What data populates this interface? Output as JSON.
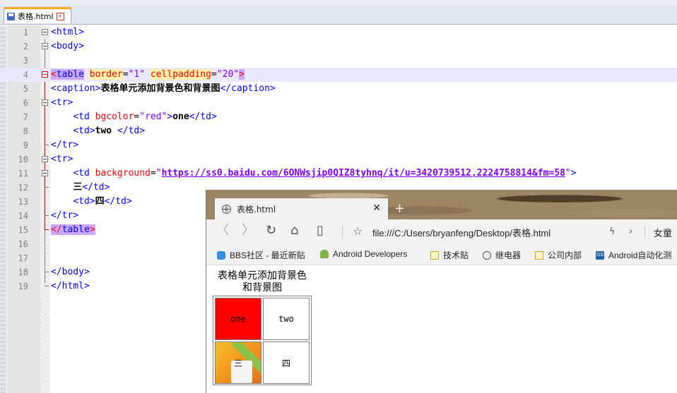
{
  "editor": {
    "tab_title": "表格.html",
    "tab_close": "x",
    "lines": [
      {
        "num": "1",
        "code": [
          {
            "c": "t",
            "s": "<html>"
          }
        ]
      },
      {
        "num": "2",
        "code": [
          {
            "c": "t",
            "s": "<body>"
          }
        ]
      },
      {
        "num": "3",
        "code": []
      },
      {
        "num": "4",
        "code": [
          {
            "c": "hl-red",
            "s": "<"
          },
          {
            "c": "t hl-tag",
            "s": "table"
          },
          {
            "c": "",
            "s": " "
          },
          {
            "c": "a hl-attr",
            "s": "border"
          },
          {
            "c": "",
            "s": "="
          },
          {
            "c": "v",
            "s": "\"1\""
          },
          {
            "c": "",
            "s": " "
          },
          {
            "c": "a hl-attr",
            "s": "cellpadding"
          },
          {
            "c": "",
            "s": "="
          },
          {
            "c": "v",
            "s": "\"20\""
          },
          {
            "c": "hl-red",
            "s": ">"
          }
        ]
      },
      {
        "num": "5",
        "code": [
          {
            "c": "t",
            "s": "<caption>"
          },
          {
            "c": "txt",
            "s": "表格单元添加背景色和背景图"
          },
          {
            "c": "t",
            "s": "</caption>"
          }
        ]
      },
      {
        "num": "6",
        "code": [
          {
            "c": "t",
            "s": "<tr>"
          }
        ]
      },
      {
        "num": "7",
        "code": [
          {
            "c": "",
            "s": "    "
          },
          {
            "c": "t",
            "s": "<td "
          },
          {
            "c": "a",
            "s": "bgcolor"
          },
          {
            "c": "",
            "s": "="
          },
          {
            "c": "v",
            "s": "\"red\""
          },
          {
            "c": "t",
            "s": ">"
          },
          {
            "c": "txt",
            "s": "one"
          },
          {
            "c": "t",
            "s": "</td>"
          }
        ]
      },
      {
        "num": "8",
        "code": [
          {
            "c": "",
            "s": "    "
          },
          {
            "c": "t",
            "s": "<td>"
          },
          {
            "c": "txt",
            "s": "two "
          },
          {
            "c": "t",
            "s": "</td>"
          }
        ]
      },
      {
        "num": "9",
        "code": [
          {
            "c": "t",
            "s": "</tr>"
          }
        ]
      },
      {
        "num": "10",
        "code": [
          {
            "c": "t",
            "s": "<tr>"
          }
        ]
      },
      {
        "num": "11",
        "code": [
          {
            "c": "",
            "s": "    "
          },
          {
            "c": "t",
            "s": "<td "
          },
          {
            "c": "a",
            "s": "background"
          },
          {
            "c": "",
            "s": "="
          },
          {
            "c": "v",
            "s": "\""
          },
          {
            "c": "url",
            "s": "https://ss0.baidu.com/6ONWsjip0QIZ8tyhnq/it/u=3420739512,2224758814&fm=58"
          },
          {
            "c": "v",
            "s": "\""
          },
          {
            "c": "t",
            "s": ">"
          }
        ]
      },
      {
        "num": "12",
        "code": [
          {
            "c": "",
            "s": "    "
          },
          {
            "c": "txt",
            "s": "三"
          },
          {
            "c": "t",
            "s": "</td>"
          }
        ]
      },
      {
        "num": "13",
        "code": [
          {
            "c": "",
            "s": "    "
          },
          {
            "c": "t",
            "s": "<td>"
          },
          {
            "c": "txt",
            "s": "四"
          },
          {
            "c": "t",
            "s": "</td>"
          }
        ]
      },
      {
        "num": "14",
        "code": [
          {
            "c": "t",
            "s": "</tr>"
          }
        ]
      },
      {
        "num": "15",
        "code": [
          {
            "c": "hl-red",
            "s": "</"
          },
          {
            "c": "t hl-tag",
            "s": "table"
          },
          {
            "c": "hl-red",
            "s": ">"
          }
        ]
      },
      {
        "num": "16",
        "code": []
      },
      {
        "num": "17",
        "code": []
      },
      {
        "num": "18",
        "code": [
          {
            "c": "t",
            "s": "</body>"
          }
        ]
      },
      {
        "num": "19",
        "code": [
          {
            "c": "t",
            "s": "</html>"
          }
        ]
      }
    ],
    "current_line": "4"
  },
  "browser": {
    "tab_title": "表格.html",
    "tab_close": "✕",
    "new_tab": "+",
    "address": "file:///C:/Users/bryanfeng/Desktop/表格.html",
    "right_text": "女童",
    "bookmarks": [
      {
        "label": "BBS社区 - 最近新贴",
        "icon": "bbs-icon"
      },
      {
        "label": "Android Developers",
        "icon": "android-icon"
      },
      {
        "label": "技术贴",
        "icon": "folder-icon"
      },
      {
        "label": "继电器",
        "icon": "globe-icon"
      },
      {
        "label": "公司内部",
        "icon": "folder-icon"
      },
      {
        "label": "Android自动化测",
        "icon": "gs-icon"
      }
    ],
    "page": {
      "caption": "表格单元添加背景色和背景图",
      "cells": [
        "one",
        "two",
        "三",
        "四"
      ]
    }
  },
  "colors": {
    "editor_current_line": "#e8e8ff",
    "tag_blue": "#0000ff",
    "attr_red": "#ff0000",
    "value_purple": "#8000ff",
    "cell_red": "#ff0000"
  }
}
